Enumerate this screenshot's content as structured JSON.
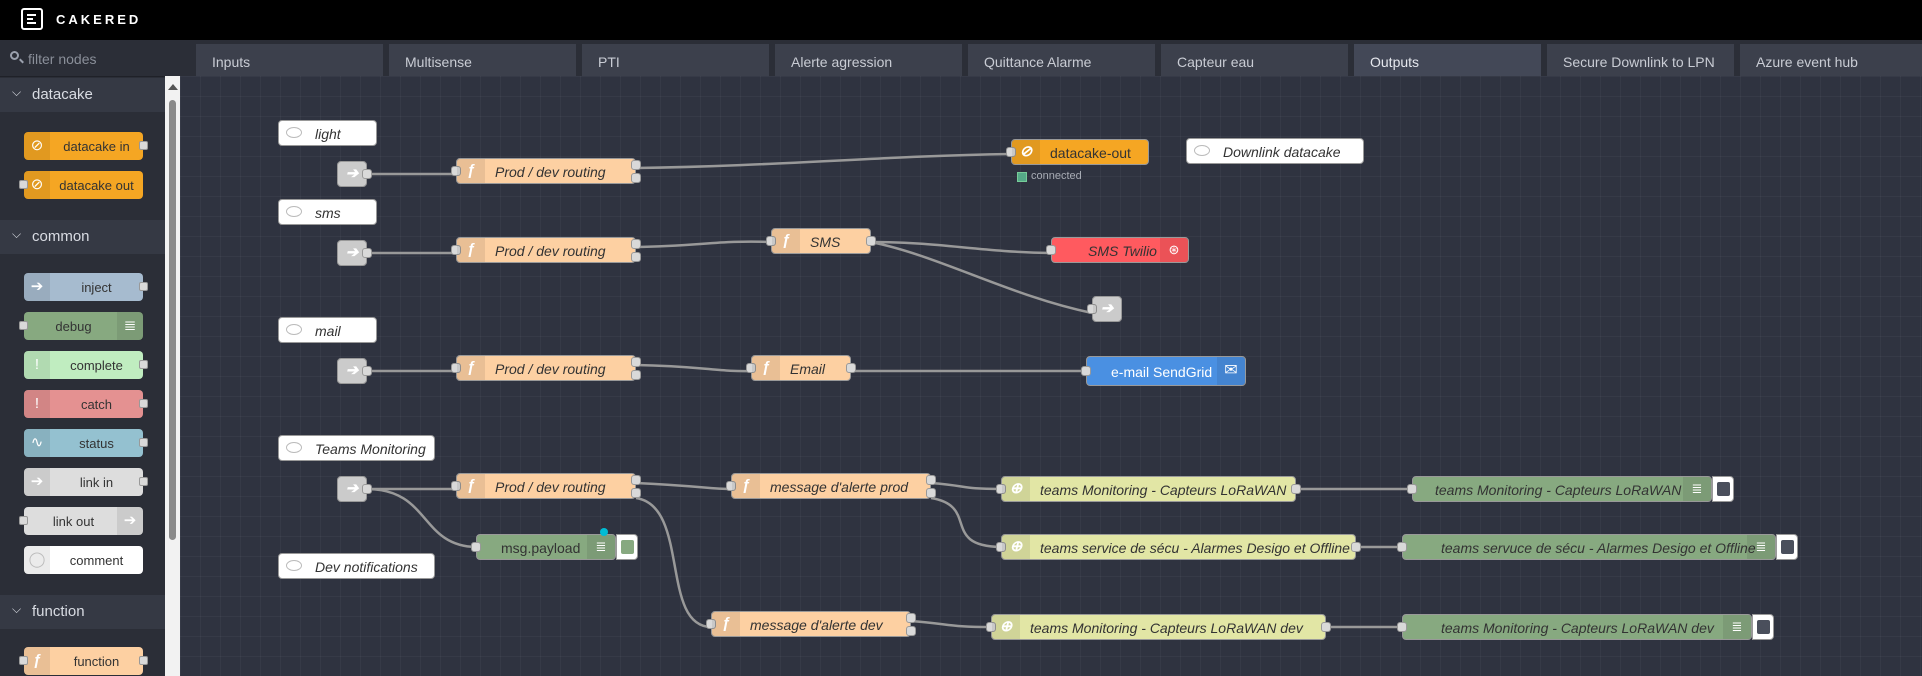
{
  "app": {
    "title": "CAKERED"
  },
  "palette": {
    "filter_placeholder": "filter nodes",
    "categories": [
      {
        "label": "datacake",
        "nodes": [
          {
            "label": "datacake in"
          },
          {
            "label": "datacake out"
          }
        ]
      },
      {
        "label": "common",
        "nodes": [
          {
            "label": "inject"
          },
          {
            "label": "debug"
          },
          {
            "label": "complete"
          },
          {
            "label": "catch"
          },
          {
            "label": "status"
          },
          {
            "label": "link in"
          },
          {
            "label": "link out"
          },
          {
            "label": "comment"
          }
        ]
      },
      {
        "label": "function",
        "nodes": [
          {
            "label": "function"
          }
        ]
      }
    ]
  },
  "tabs": [
    {
      "label": "Inputs"
    },
    {
      "label": "Multisense"
    },
    {
      "label": "PTI"
    },
    {
      "label": "Alerte agression"
    },
    {
      "label": "Quittance Alarme"
    },
    {
      "label": "Capteur eau"
    },
    {
      "label": "Outputs",
      "active": true
    },
    {
      "label": "Secure Downlink to LPN"
    },
    {
      "label": "Azure event hub"
    }
  ],
  "flow": {
    "comments": {
      "light": "light",
      "sms": "sms",
      "mail": "mail",
      "teams_monitoring": "Teams Monitoring",
      "dev_notifications": "Dev notifications",
      "downlink_datacake": "Downlink datacake"
    },
    "nodes": {
      "routing_light": "Prod / dev routing",
      "routing_sms": "Prod / dev routing",
      "routing_mail": "Prod / dev routing",
      "routing_teams": "Prod / dev routing",
      "datacake_out": "datacake-out",
      "datacake_status": "connected",
      "sms_function": "SMS",
      "sms_twilio": "SMS Twilio",
      "email_function": "Email",
      "email_sendgrid": "e-mail SendGrid",
      "msg_payload": "msg.payload",
      "msg_prod": "message d'alerte prod",
      "msg_dev": "message d'alerte dev",
      "teams_prod": "teams Monitoring - Capteurs LoRaWAN",
      "teams_secu": "teams service de sécu - Alarmes Desigo et Offline",
      "teams_dev": "teams Monitoring - Capteurs LoRaWAN dev",
      "debug_prod": "teams Monitoring - Capteurs LoRaWAN",
      "debug_secu": "teams servuce de sécu - Alarmes Desigo et Offline",
      "debug_dev": "teams Monitoring - Capteurs LoRaWAN dev"
    }
  },
  "colors": {
    "function": "#fdd0a2",
    "datacake": "#f5a623",
    "twilio": "#ff5a5f",
    "sendgrid": "#4a90e2",
    "teams": "#e2e6a5",
    "debug": "#87a980"
  }
}
